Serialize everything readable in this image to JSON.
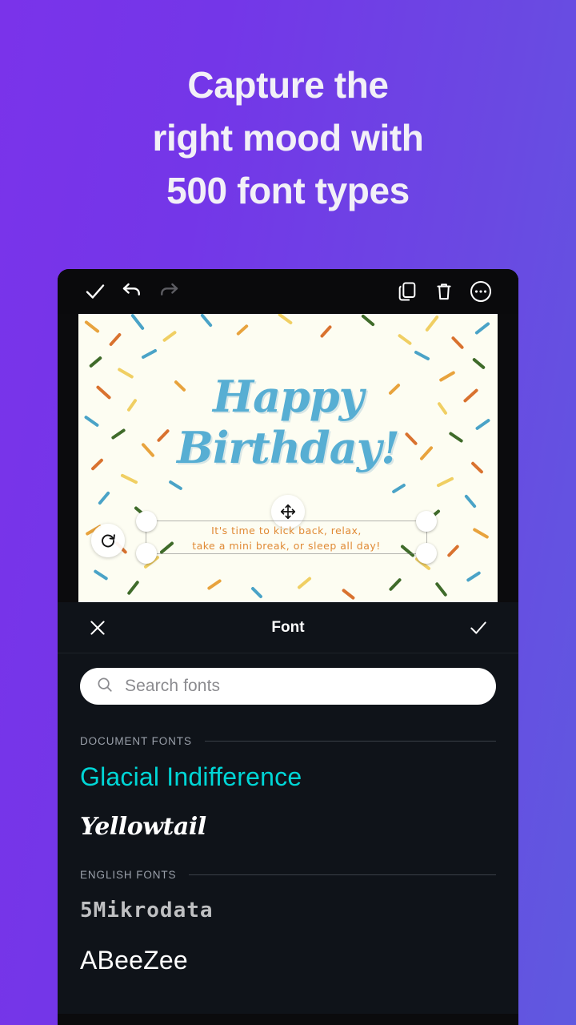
{
  "promo": {
    "headline_lines": [
      "Capture the",
      "right mood with",
      "500 font types"
    ],
    "bg_gradient_from": "#7a33ea",
    "bg_gradient_to": "#5f59e0",
    "text_color": "#f2f0f7"
  },
  "editor_toolbar": {
    "icons": [
      {
        "name": "check-icon",
        "label": "Done",
        "state": "active"
      },
      {
        "name": "undo-icon",
        "label": "Undo",
        "state": "active"
      },
      {
        "name": "redo-icon",
        "label": "Redo",
        "state": "disabled"
      },
      {
        "name": "duplicate-icon",
        "label": "Duplicate",
        "state": "active"
      },
      {
        "name": "trash-icon",
        "label": "Delete",
        "state": "active"
      },
      {
        "name": "more-icon",
        "label": "More options",
        "state": "active"
      }
    ]
  },
  "canvas": {
    "background_color": "#fdfdf2",
    "title_lines": [
      "Happy",
      "Birthday!"
    ],
    "title_color": "#57aed3",
    "subtitle_lines": [
      "It's time to kick back, relax,",
      "take a mini break, or sleep all day!"
    ],
    "subtitle_color": "#e08a35",
    "selection": {
      "move_handle": "move-handle-icon",
      "rotate_handle": "rotate-handle-icon",
      "corner_handles": 4
    },
    "confetti_colors": [
      "#4aa3c7",
      "#e8a33d",
      "#d9722f",
      "#3f6b2a",
      "#f0cf63"
    ]
  },
  "font_panel": {
    "title": "Font",
    "close_label": "Close",
    "confirm_label": "Apply",
    "search": {
      "placeholder": "Search fonts",
      "value": "",
      "icon": "search-icon"
    },
    "sections": [
      {
        "label": "DOCUMENT FONTS",
        "fonts": [
          {
            "name": "Glacial Indifference",
            "selected": true,
            "color": "#00d6d6"
          },
          {
            "name": "Yellowtail",
            "selected": false,
            "color": "#ffffff"
          }
        ]
      },
      {
        "label": "ENGLISH FONTS",
        "fonts": [
          {
            "name": "5Mikrodata",
            "selected": false,
            "color": "#d8d8da"
          },
          {
            "name": "ABeeZee",
            "selected": false,
            "color": "#ffffff"
          }
        ]
      }
    ]
  }
}
